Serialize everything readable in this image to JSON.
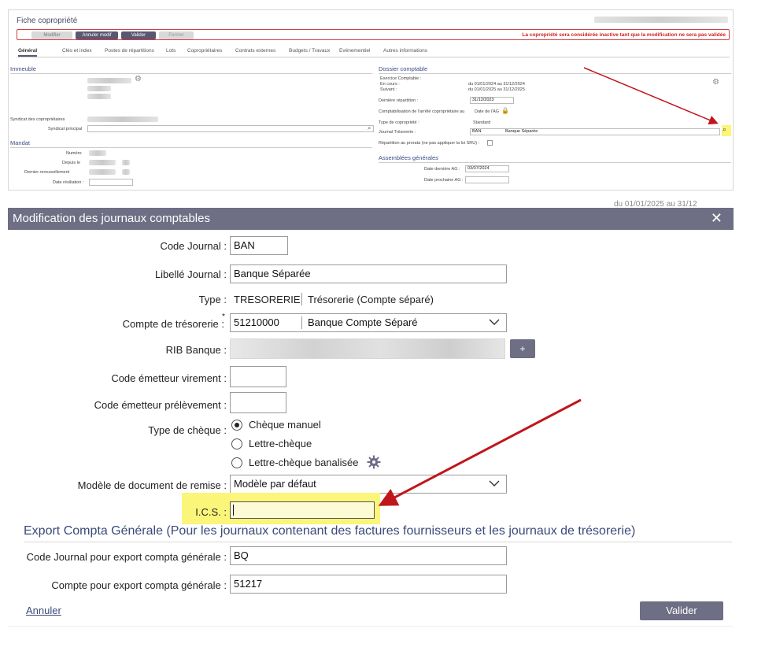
{
  "background_window": {
    "title": "Fiche copropriété",
    "toolbar": {
      "modifier": "Modifier",
      "annuler_modif": "Annuler modif",
      "valider": "Valider",
      "fermer": "Fermer",
      "warning": "La copropriété sera considérée inactive tant que la modification ne sera pas validée"
    },
    "tabs": [
      "Général",
      "Clés et index",
      "Postes de répartitions",
      "Lots",
      "Copropriétaires",
      "Contrats externes",
      "Budgets / Travaux",
      "Evénementiel",
      "Autres informations"
    ],
    "left": {
      "immeuble": "Immeuble",
      "syndicat_coproprietaires": "Syndicat des copropriétaires",
      "syndicat_principal": "Syndicat principal",
      "mandat": "Mandat",
      "numero": "Numéro",
      "depuis_le": "Depuis le",
      "dernier_renouvellement": "Dernier renouvellement",
      "date_resiliation": "Date résiliation :"
    },
    "right": {
      "dossier_comptable": "Dossier comptable",
      "exercice_comptable": "Exercice Comptable :",
      "en_cours": "En cours :",
      "en_cours_value": "du 01/01/2024 au 31/12/2024",
      "suivant": "Suivant :",
      "suivant_value": "du 01/01/2025 au 31/12/2025",
      "derniere_repartition": "Dernière répartition :",
      "derniere_repartition_value": "31/12/2023",
      "comptabilisation": "Comptabilisation de l'arrêté copropriétaire au",
      "comptabilisation_value": "Date de l'AG",
      "type_copropriete": "Type de copropriété :",
      "type_copropriete_value": "Standard",
      "journal_tresorerie": "Journal Trésorerie :",
      "journal_code": "BAN",
      "journal_label": "Banque Séparée",
      "repartition_prorata": "Répartition au prorata (ne pas appliquer la loi SRU) :",
      "assemblees_generales": "Assemblées générales",
      "date_derniere_ag": "Date dernière AG :",
      "date_derniere_ag_value": "03/07/2024",
      "date_prochaine_ag": "Date prochaine AG :",
      "partial_bottom": "du 01/01/2025 au 31/12"
    }
  },
  "modal": {
    "title": "Modification des journaux comptables",
    "close": "✕",
    "code_journal_label": "Code Journal :",
    "code_journal_value": "BAN",
    "libelle_label": "Libellé Journal :",
    "libelle_value": "Banque Séparée",
    "type_label": "Type :",
    "type_code": "TRESORERIE",
    "type_desc": "Trésorerie (Compte séparé)",
    "compte_tresorerie_label": "Compte de trésorerie :",
    "compte_tresorerie_required": "*",
    "compte_tresorerie_code": "51210000",
    "compte_tresorerie_name": "Banque Compte Séparé",
    "rib_label": "RIB Banque :",
    "rib_add": "+",
    "emetteur_virement_label": "Code émetteur virement :",
    "emetteur_virement_value": "",
    "emetteur_prelevement_label": "Code émetteur prélèvement :",
    "emetteur_prelevement_value": "",
    "type_cheque_label": "Type de chèque :",
    "cheque_options": [
      {
        "label": "Chèque manuel",
        "selected": true
      },
      {
        "label": "Lettre-chèque",
        "selected": false
      },
      {
        "label": "Lettre-chèque banalisée",
        "selected": false
      }
    ],
    "modele_label": "Modèle de document de remise :",
    "modele_value": "Modèle par défaut",
    "ics_label": "I.C.S. :",
    "ics_value": "",
    "export_title": "Export Compta Générale (Pour les journaux contenant des factures fournisseurs et les journaux de trésorerie)",
    "export_code_label": "Code Journal pour export compta générale :",
    "export_code_value": "BQ",
    "export_compte_label": "Compte pour export compta générale :",
    "export_compte_value": "51217",
    "cancel": "Annuler",
    "validate": "Valider"
  },
  "colors": {
    "modal_header": "#6e6e85",
    "button": "#6e6e85",
    "highlight": "#fbf57a",
    "annotation_arrow": "#c0161b",
    "warning": "#d02020"
  }
}
